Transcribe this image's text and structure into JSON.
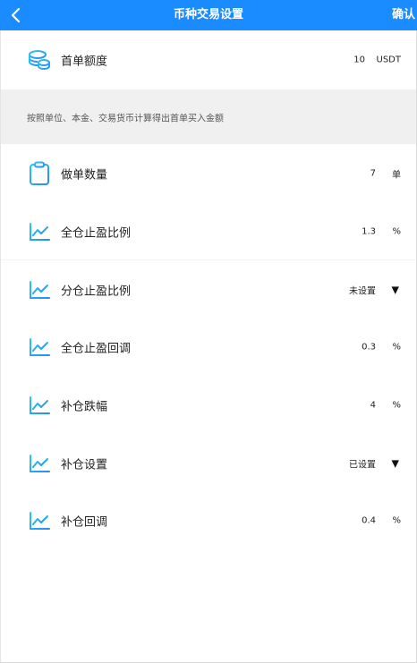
{
  "header": {
    "title": "币种交易设置",
    "confirm_label": "确认",
    "background": "#1a8cff"
  },
  "first_order": {
    "label": "首单额度",
    "value": "10",
    "unit": "USDT",
    "icon": "coins-icon"
  },
  "note": "按照单位、本金、交易货币计算得出首单买入金额",
  "settings": [
    {
      "label": "做单数量",
      "value": "7",
      "unit": "单",
      "icon": "clipboard-icon"
    },
    {
      "label": "全仓止盈比例",
      "value": "1.3",
      "unit": "%",
      "icon": "chart-line-icon"
    },
    {
      "label": "分仓止盈比例",
      "value": "未设置",
      "dropdown": true,
      "icon": "chart-line-icon"
    },
    {
      "label": "全仓止盈回调",
      "value": "0.3",
      "unit": "%",
      "icon": "chart-line-icon"
    },
    {
      "label": "补仓跌幅",
      "value": "4",
      "unit": "%",
      "icon": "chart-line-icon"
    },
    {
      "label": "补仓设置",
      "value": "已设置",
      "dropdown": true,
      "icon": "chart-line-icon"
    },
    {
      "label": "补仓回调",
      "value": "0.4",
      "unit": "%",
      "icon": "chart-line-icon"
    }
  ],
  "dropdown_caret": "▼"
}
